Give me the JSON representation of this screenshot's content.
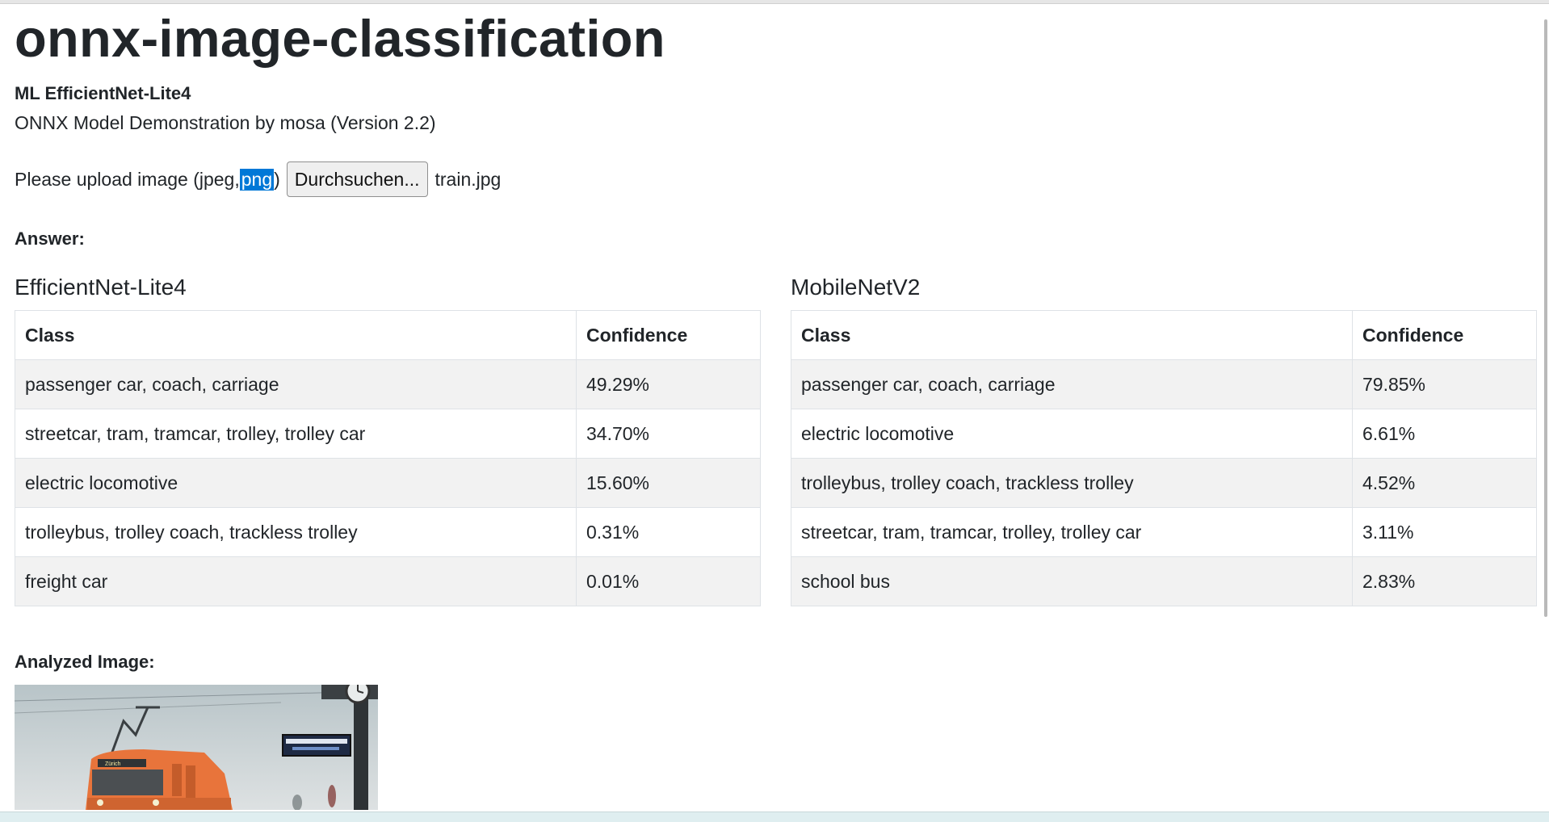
{
  "page": {
    "title": "onnx-image-classification",
    "model_name": "ML EfficientNet-Lite4",
    "byline": "ONNX Model Demonstration by mosa (Version 2.2)"
  },
  "upload": {
    "label_prefix": "Please upload image (jpeg,",
    "label_selected": "png",
    "label_suffix": ")",
    "button_label": "Durchsuchen...",
    "file_name": "train.jpg"
  },
  "answer_label": "Answer:",
  "results": [
    {
      "title": "EfficientNet-Lite4",
      "header_class": "Class",
      "header_confidence": "Confidence",
      "rows": [
        {
          "class": "passenger car, coach, carriage",
          "confidence": "49.29%"
        },
        {
          "class": "streetcar, tram, tramcar, trolley, trolley car",
          "confidence": "34.70%"
        },
        {
          "class": "electric locomotive",
          "confidence": "15.60%"
        },
        {
          "class": "trolleybus, trolley coach, trackless trolley",
          "confidence": "0.31%"
        },
        {
          "class": "freight car",
          "confidence": "0.01%"
        }
      ]
    },
    {
      "title": "MobileNetV2",
      "header_class": "Class",
      "header_confidence": "Confidence",
      "rows": [
        {
          "class": "passenger car, coach, carriage",
          "confidence": "79.85%"
        },
        {
          "class": "electric locomotive",
          "confidence": "6.61%"
        },
        {
          "class": "trolleybus, trolley coach, trackless trolley",
          "confidence": "4.52%"
        },
        {
          "class": "streetcar, tram, tramcar, trolley, trolley car",
          "confidence": "3.11%"
        },
        {
          "class": "school bus",
          "confidence": "2.83%"
        }
      ]
    }
  ],
  "analyzed_label": "Analyzed Image:",
  "colors": {
    "selection": "#0078d7",
    "stripe": "#f2f2f2",
    "train_orange": "#e8743b"
  }
}
